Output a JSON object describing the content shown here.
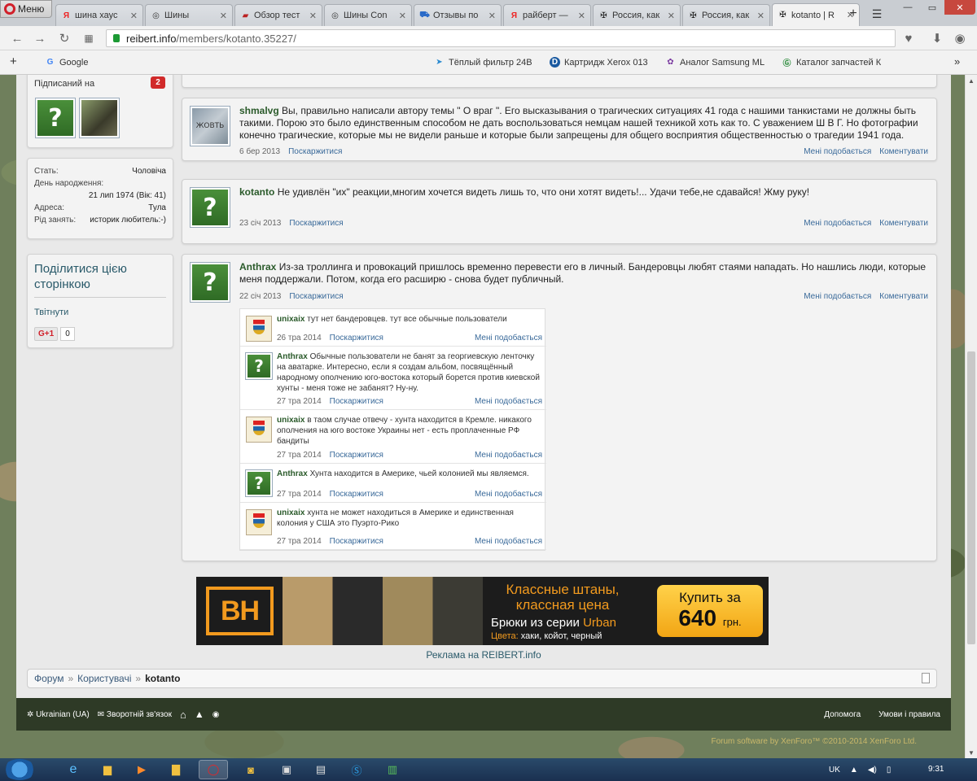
{
  "browser": {
    "menu_label": "Меню",
    "tabs": [
      {
        "title": "шина хаус",
        "icon": "yandex-icon"
      },
      {
        "title": "Шины",
        "icon": "wheel-icon"
      },
      {
        "title": "Обзор тест",
        "icon": "site-icon"
      },
      {
        "title": "Шины Con",
        "icon": "wheel-icon"
      },
      {
        "title": "Отзывы по",
        "icon": "cart-icon"
      },
      {
        "title": "райберт —",
        "icon": "yandex-icon"
      },
      {
        "title": "Россия, как",
        "icon": "cross-icon"
      },
      {
        "title": "Россия, как",
        "icon": "cross-icon"
      },
      {
        "title": "kotanto | R",
        "icon": "cross-icon",
        "active": true
      }
    ],
    "url_domain": "reibert.info",
    "url_path": "/members/kotanto.35227/",
    "bookmarks": [
      {
        "label": "Google",
        "icon": "google-icon"
      },
      {
        "label": "Тёплый фильтр 24В",
        "icon": "bookmark-icon"
      },
      {
        "label": "Картридж Xerox 013",
        "icon": "bookmark-icon"
      },
      {
        "label": "Аналог Samsung ML",
        "icon": "bookmark-icon"
      },
      {
        "label": "Каталог запчастей К",
        "icon": "bookmark-icon"
      }
    ]
  },
  "sidebar": {
    "following_title": "Підписаний на",
    "following_count": "2",
    "info": [
      {
        "k": "Стать:",
        "v": "Чоловіча"
      },
      {
        "k": "День народження:",
        "v": ""
      },
      {
        "k": "",
        "v": "21 лип 1974 (Вік: 41)"
      },
      {
        "k": "Адреса:",
        "v": "Тула"
      },
      {
        "k": "Рід занять:",
        "v": "историк любитель:-)"
      }
    ],
    "share_title": "Поділитися цією сторінкою",
    "tweet": "Твітнути",
    "gplus": "G+1",
    "gplus_count": "0"
  },
  "posts": [
    {
      "user": "shmalvg",
      "text": "Вы, правильно написали автору темы \" О враг \". Его высказывания о трагических ситуациях 41 года с нашими танкистами не должны быть такими. Порою это было единственным способом не дать воспользоваться немцам нашей техникой хоть как то. С уважением Ш В Г. Но фотографии конечно трагические, которые мы не видели раньше и которые были запрещены для общего восприятия общественностью о трагедии 1941 года.",
      "date": "6 бер 2013",
      "report": "Поскаржитися",
      "like": "Мені подобається",
      "comment": "Коментувати",
      "avatar_text": "ЖОВТЬ"
    },
    {
      "user": "kotanto",
      "text": "Не удивлён \"их\" реакции,многим хочется видеть лишь то, что они хотят видеть!... Удачи тебе,не сдавайся! Жму руку!",
      "date": "23 січ 2013",
      "report": "Поскаржитися",
      "like": "Мені подобається",
      "comment": "Коментувати"
    },
    {
      "user": "Anthrax",
      "text": "Из-за троллинга и провокаций пришлось временно перевести его в личный. Бандеровцы любят стаями нападать. Но нашлись люди, которые меня поддержали. Потом, когда его расширю - снова будет публичный.",
      "date": "22 січ 2013",
      "report": "Поскаржитися",
      "like": "Мені подобається",
      "comment": "Коментувати"
    }
  ],
  "comments": [
    {
      "user": "unixaix",
      "text": "тут нет бандеровцев. тут все обычные пользователи",
      "date": "26 тра 2014",
      "report": "Поскаржитися",
      "like": "Мені подобається"
    },
    {
      "user": "Anthrax",
      "text": "Обычные пользователи не банят за георгиевскую ленточку на аватарке. Интересно, если я создам альбом, посвящённый народному ополчению юго-востока который борется против киевской хунты - меня тоже не забанят? Ну-ну.",
      "date": "27 тра 2014",
      "report": "Поскаржитися",
      "like": "Мені подобається"
    },
    {
      "user": "unixaix",
      "text": "в таом случае отвечу - хунта находится в Кремле. никакого ополчения на юго востоке Украины нет - есть проплаченные РФ бандиты",
      "date": "27 тра 2014",
      "report": "Поскаржитися",
      "like": "Мені подобається"
    },
    {
      "user": "Anthrax",
      "text": "Хунта находится в Америке, чьей колонией мы являемся.",
      "date": "27 тра 2014",
      "report": "Поскаржитися",
      "like": "Мені подобається"
    },
    {
      "user": "unixaix",
      "text": "хунта не может находиться в Америке и единственная колония у США это Пуэрто-Рико",
      "date": "27 тра 2014",
      "report": "Поскаржитися",
      "like": "Мені подобається"
    }
  ],
  "ad": {
    "logo": "BH",
    "headline": "Классные штаны, классная цена",
    "line2_a": "Брюки из серии ",
    "line2_b": "Urban",
    "line3_a": "Цвета:",
    "line3_b": " хаки, койот, черный",
    "buy_a": "Купить за",
    "buy_b": "640",
    "buy_c": "грн.",
    "caption": "Реклама на REIBERT.info"
  },
  "breadcrumb": [
    "Форум",
    "Користувачі",
    "kotanto"
  ],
  "footer": {
    "lang": "Ukrainian (UA)",
    "contact": "Зворотній зв'язок",
    "help": "Допомога",
    "terms": "Умови і правила",
    "copyright": "Forum software by XenForo™ ©2010-2014 XenForo Ltd."
  },
  "taskbar": {
    "lang": "UK",
    "time": "9:31"
  },
  "colors": {
    "accent": "#2a5a2a",
    "link": "#3a6a9a",
    "badge": "#d12a2a"
  }
}
